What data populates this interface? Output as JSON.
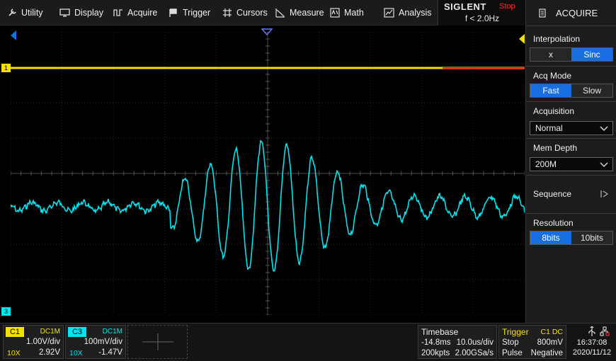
{
  "menu": [
    {
      "label": "Utility",
      "icon": "wrench-icon"
    },
    {
      "label": "Display",
      "icon": "monitor-icon"
    },
    {
      "label": "Acquire",
      "icon": "acquire-wave-icon"
    },
    {
      "label": "Trigger",
      "icon": "trigger-flag-icon"
    },
    {
      "label": "Cursors",
      "icon": "cursors-icon"
    },
    {
      "label": "Measure",
      "icon": "measure-icon"
    },
    {
      "label": "Math",
      "icon": "math-icon"
    },
    {
      "label": "Analysis",
      "icon": "analysis-icon"
    }
  ],
  "brand": {
    "name": "SIGLENT",
    "status": "Stop",
    "frequency": "f < 2.0Hz"
  },
  "panel": {
    "title": "ACQUIRE",
    "interpolation": {
      "title": "Interpolation",
      "options": [
        "x",
        "Sinc"
      ],
      "selected": "Sinc"
    },
    "acq_mode": {
      "title": "Acq Mode",
      "options": [
        "Fast",
        "Slow"
      ],
      "selected": "Fast"
    },
    "acquisition": {
      "title": "Acquisition",
      "value": "Normal"
    },
    "mem_depth": {
      "title": "Mem Depth",
      "value": "200M"
    },
    "sequence": {
      "title": "Sequence"
    },
    "resolution": {
      "title": "Resolution",
      "options": [
        "8bits",
        "10bits"
      ],
      "selected": "8bits"
    }
  },
  "channels": [
    {
      "tag": "C1",
      "coupling": "DC1M",
      "scale": "1.00V/div",
      "probe": "10X",
      "offset": "2.92V",
      "color": "#f5e100"
    },
    {
      "tag": "C3",
      "coupling": "DC1M",
      "scale": "100mV/div",
      "probe": "10X",
      "offset": "-1.47V",
      "color": "#00e5f0"
    }
  ],
  "markers": {
    "c1_tag": "1",
    "c3_tag": "3"
  },
  "timebase": {
    "title": "Timebase",
    "delay": "-14.8ms",
    "scale": "10.0us/div",
    "points": "200kpts",
    "rate": "2.00GSa/s"
  },
  "trigger": {
    "title": "Trigger",
    "source": "C1 DC",
    "state": "Stop",
    "level": "800mV",
    "type": "Pulse",
    "slope": "Negative"
  },
  "clock": {
    "time": "16:37:08",
    "date": "2020/11/12"
  },
  "colors": {
    "c1": "#f5e100",
    "c3": "#00e5f0",
    "accent": "#1a6fe0",
    "stop": "#ff2a2a"
  }
}
